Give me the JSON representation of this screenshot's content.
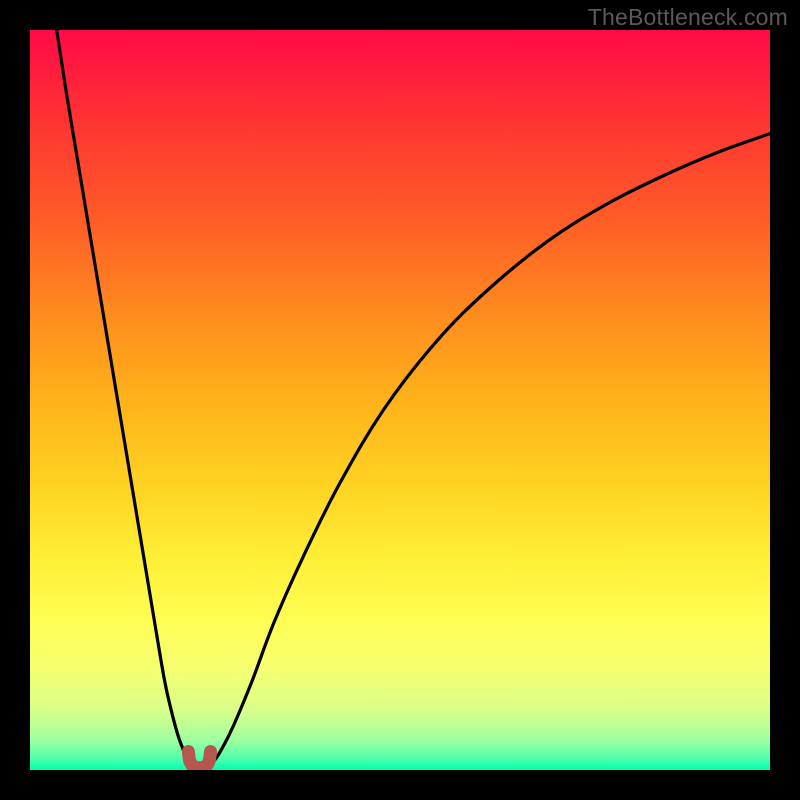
{
  "watermark": {
    "text": "TheBottleneck.com"
  },
  "colors": {
    "frame": "#000000",
    "curve": "#000000",
    "marker_fill": "#b6574e",
    "marker_stroke": "#8a3a33",
    "gradient_stops": [
      "#ff0b47",
      "#ff1a3f",
      "#ff3333",
      "#ff5a28",
      "#ff8a1f",
      "#ffb21a",
      "#ffd423",
      "#fff038",
      "#fffe55",
      "#f7ff70",
      "#d8ff8a",
      "#9fffa0",
      "#4dffab",
      "#00ffb0"
    ]
  },
  "chart_data": {
    "type": "line",
    "title": "",
    "xlabel": "",
    "ylabel": "",
    "xlim": [
      0,
      100
    ],
    "ylim": [
      0,
      100
    ],
    "grid": false,
    "note": "x and y are normalized 0–100 across the plot area; data labels not shown in source image, values estimated from pixel positions",
    "series": [
      {
        "name": "left-branch",
        "x": [
          3.6,
          5,
          6.5,
          8,
          9.5,
          11,
          12.5,
          14,
          15.5,
          17,
          18.2,
          19.1,
          19.9,
          20.6,
          21.1,
          21.5,
          21.8
        ],
        "y": [
          100,
          91,
          82,
          73,
          64,
          55,
          46,
          37,
          28,
          19,
          12,
          8,
          5,
          3,
          1.8,
          1.0,
          0.6
        ]
      },
      {
        "name": "right-branch",
        "x": [
          24.2,
          25,
          26,
          27.5,
          30,
          33,
          37,
          42,
          48,
          55,
          62,
          70,
          78,
          86,
          93,
          100
        ],
        "y": [
          0.6,
          1.4,
          3,
          6,
          12,
          20,
          29,
          39,
          49,
          58,
          65,
          71.5,
          76.5,
          80.5,
          83.5,
          86
        ]
      },
      {
        "name": "minimum-marker",
        "shape": "u",
        "x": [
          21.4,
          21.6,
          22.1,
          22.9,
          23.7,
          24.2,
          24.4
        ],
        "y": [
          2.5,
          1.2,
          0.5,
          0.3,
          0.5,
          1.2,
          2.5
        ]
      }
    ]
  }
}
